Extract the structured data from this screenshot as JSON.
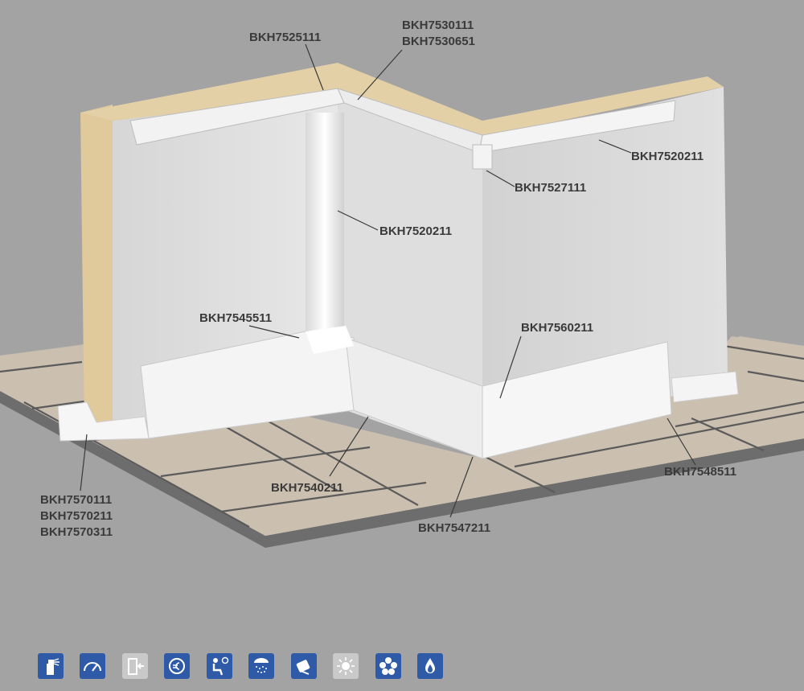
{
  "labels": {
    "top_left": "BKH7525111",
    "top_middle": [
      "BKH7530111",
      "BKH7530651"
    ],
    "right_coving": "BKH7520211",
    "corner_piece": "BKH7527111",
    "vertical_profile": "BKH7520211",
    "skirting_corner": "BKH7545511",
    "end_cap": "BKH7560211",
    "bottom_left": [
      "BKH7570111",
      "BKH7570211",
      "BKH7570311"
    ],
    "floor_inner": "BKH7540211",
    "floor_corner": "BKH7547211",
    "right_skirting_end": "BKH7548511"
  },
  "feature_icons": [
    {
      "name": "spray-cleaning-icon",
      "color": "#2f5aa8"
    },
    {
      "name": "gauge-icon",
      "color": "#2f5aa8"
    },
    {
      "name": "door-entry-icon",
      "color": "#c9c9c9"
    },
    {
      "name": "euro-icon",
      "color": "#2f5aa8"
    },
    {
      "name": "person-seat-icon",
      "color": "#2f5aa8"
    },
    {
      "name": "shower-icon",
      "color": "#2f5aa8"
    },
    {
      "name": "hand-wipe-icon",
      "color": "#2f5aa8"
    },
    {
      "name": "sun-burst-icon",
      "color": "#c9c9c9"
    },
    {
      "name": "flower-gear-icon",
      "color": "#2f5aa8"
    },
    {
      "name": "flame-icon",
      "color": "#2f5aa8"
    }
  ],
  "colors": {
    "background": "#a3a3a3",
    "wall": "#dcdcdc",
    "insulation": "#e4d0a6",
    "floor_tile": "#c9beaf",
    "grout": "#5b5b5b",
    "label_text": "#3a3a3a",
    "icon_blue": "#2f5aa8"
  }
}
